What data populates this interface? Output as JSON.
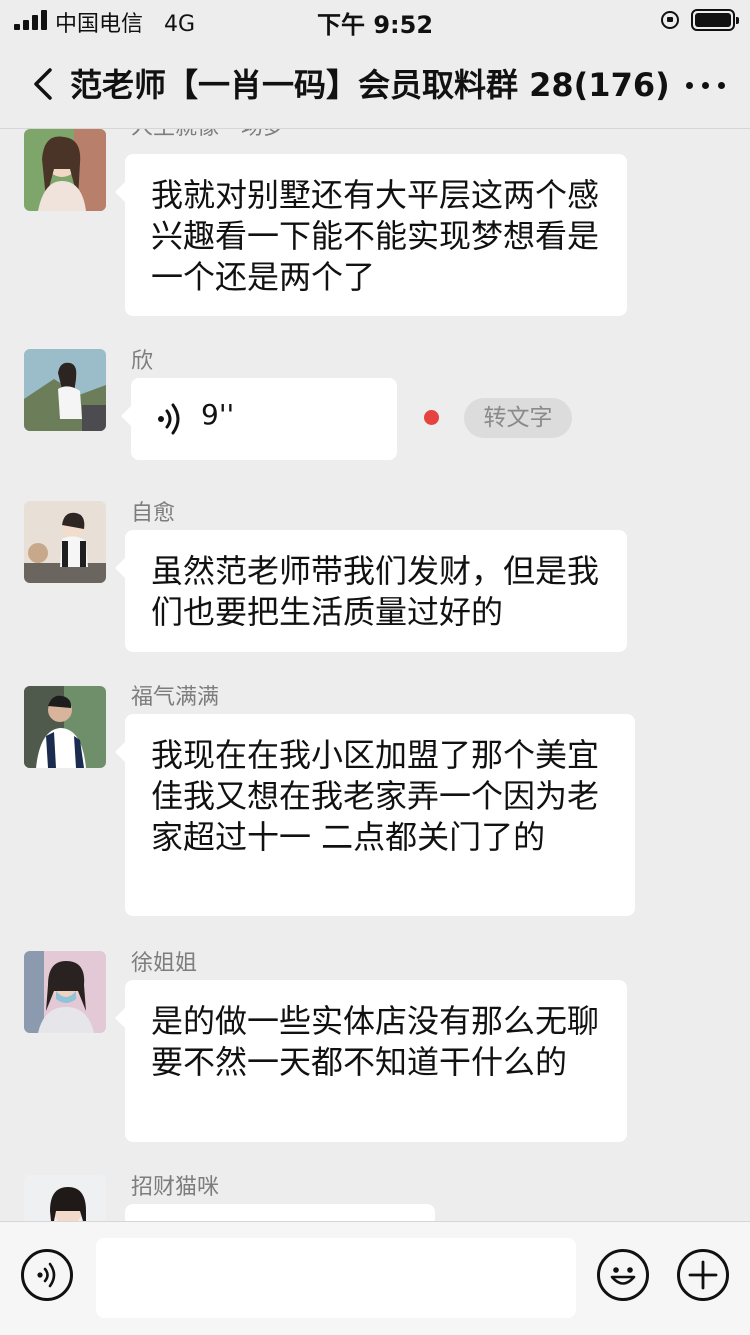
{
  "status_bar": {
    "carrier": "中国电信",
    "network": "4G",
    "time": "下午 9:52"
  },
  "nav": {
    "title": "范老师【一肖一码】会员取料群 28(176)"
  },
  "messages": [
    {
      "sender": "人生就像一场梦",
      "text": "我就对别墅还有大平层这两个感兴趣看一下能不能实现梦想看是一个还是两个了"
    },
    {
      "sender": "欣",
      "duration": "9''",
      "to_text_label": "转文字"
    },
    {
      "sender": "自愈",
      "text": "虽然范老师带我们发财，但是我们也要把生活质量过好的"
    },
    {
      "sender": "福气满满",
      "text": "我现在在我小区加盟了那个美宜佳我又想在我老家弄一个因为老家超过十一 二点都关门了的"
    },
    {
      "sender": "徐姐姐",
      "text": "是的做一些实体店没有那么无聊要不然一天都不知道干什么的"
    },
    {
      "sender": "招财猫咪",
      "text": ""
    }
  ],
  "input_bar": {
    "placeholder": ""
  },
  "colors": {
    "background": "#ededed",
    "bubble": "#ffffff",
    "unread_dot": "#e64340",
    "sender_name": "#7d7d7d"
  }
}
